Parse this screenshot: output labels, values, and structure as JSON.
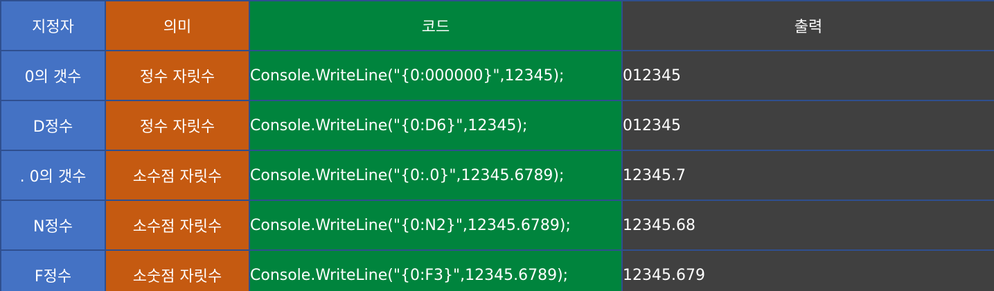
{
  "headers": {
    "specifier": "지정자",
    "meaning": "의미",
    "code": "코드",
    "output": "출력"
  },
  "rows": [
    {
      "specifier": "0의 갯수",
      "meaning": "정수 자릿수",
      "code": "Console.WriteLine(\"{0:000000}\",12345);",
      "output": "012345"
    },
    {
      "specifier": "D정수",
      "meaning": "정수 자릿수",
      "code": "Console.WriteLine(\"{0:D6}\",12345);",
      "output": "012345"
    },
    {
      "specifier": ". 0의 갯수",
      "meaning": "소수점 자릿수",
      "code": "Console.WriteLine(\"{0:.0}\",12345.6789);",
      "output": "12345.7"
    },
    {
      "specifier": "N정수",
      "meaning": "소수점 자릿수",
      "code": "Console.WriteLine(\"{0:N2}\",12345.6789);",
      "output": "12345.68"
    },
    {
      "specifier": "F정수",
      "meaning": "소숫점 자릿수",
      "code": "Console.WriteLine(\"{0:F3}\",12345.6789);",
      "output": "12345.679"
    }
  ],
  "colors": {
    "specifier_column": "#4472c4",
    "meaning_column": "#c55a11",
    "code_column": "#00843d",
    "output_column": "#404040",
    "border": "#2f4f8f"
  }
}
